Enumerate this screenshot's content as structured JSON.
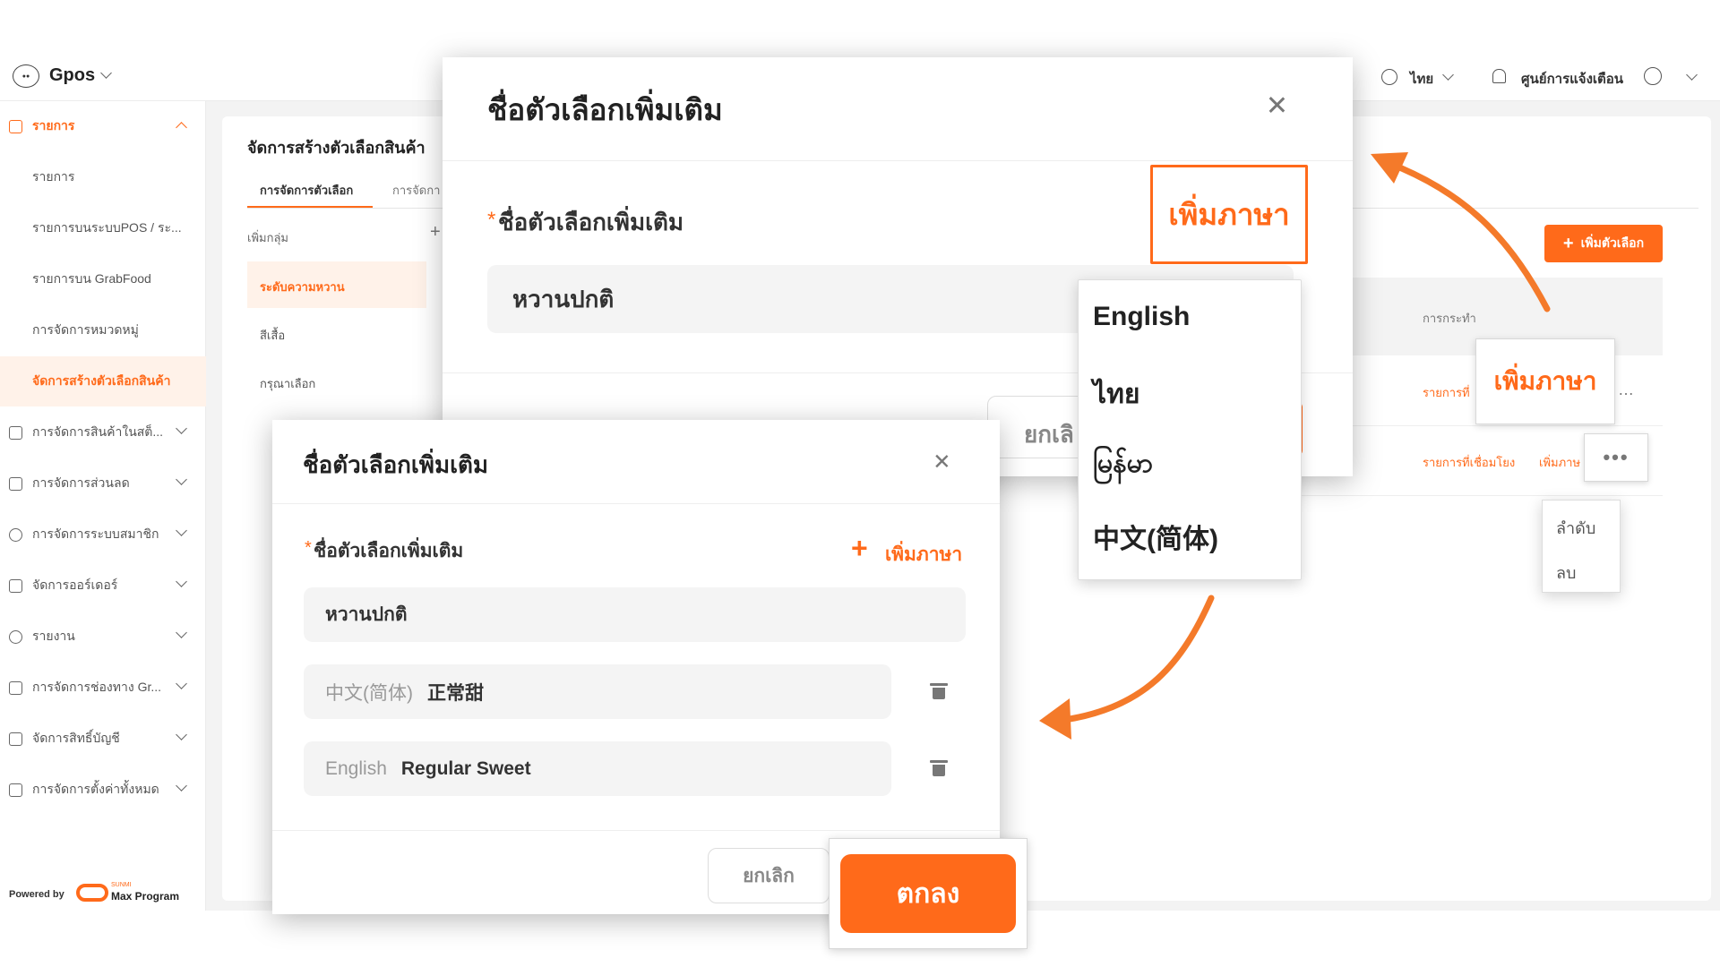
{
  "app": {
    "brand": "Gpos",
    "language": "ไทย",
    "notifications": "ศูนย์การแจ้งเตือน"
  },
  "sidebar": {
    "items": [
      {
        "label": "รายการ"
      },
      {
        "label": "รายการ"
      },
      {
        "label": "รายการบนระบบPOS / ระ..."
      },
      {
        "label": "รายการบน GrabFood"
      },
      {
        "label": "การจัดการหมวดหมู่"
      },
      {
        "label": "จัดการสร้างตัวเลือกสินค้า"
      },
      {
        "label": "การจัดการสินค้าในสต็..."
      },
      {
        "label": "การจัดการส่วนลด"
      },
      {
        "label": "การจัดการระบบสมาชิก"
      },
      {
        "label": "จัดการออร์เดอร์"
      },
      {
        "label": "รายงาน"
      },
      {
        "label": "การจัดการช่องทาง Gr..."
      },
      {
        "label": "จัดการสิทธิ์บัญชี"
      },
      {
        "label": "การจัดการตั้งค่าทั้งหมด"
      }
    ],
    "powered_by": "Powered by",
    "powered_brand": "Max Program",
    "powered_brand_small": "SUNMI"
  },
  "page": {
    "title": "จัดการสร้างตัวเลือกสินค้า",
    "tabs": [
      "การจัดการตัวเลือก",
      "การจัดกา"
    ],
    "add_group": "เพิ่มกลุ่ม",
    "add_group_icon": "+",
    "groups": [
      "ระดับความหวาน",
      "สีเสื้อ",
      "กรุณาเลือก"
    ],
    "add_option_button": "เพิ่มตัวเลือก",
    "table_header_action": "การกระทำ",
    "row1_action": "รายการที่",
    "row2_action_link": "รายการที่เชื่อมโยง",
    "row2_action_add": "เพิ่มภาษ",
    "more_menu": [
      "ลำดับ",
      "ลบ"
    ]
  },
  "modal_back": {
    "title": "ชื่อตัวเลือกเพิ่มเติม",
    "field_label": "ชื่อตัวเลือกเพิ่มเติม",
    "required_mark": "*",
    "field_value": "หวานปกติ",
    "add_language_button": "เพิ่มภาษา",
    "cancel": "ยกเลิ"
  },
  "language_dropdown": {
    "options": [
      "English",
      "ไทย",
      "မြန်မာ",
      "中文(简体)"
    ]
  },
  "callout_right": "เพิ่มภาษา",
  "modal_front": {
    "title": "ชื่อตัวเลือกเพิ่มเติม",
    "field_label": "ชื่อตัวเลือกเพิ่มเติม",
    "required_mark": "*",
    "add_language": "เพิ่มภาษา",
    "field_value": "หวานปกติ",
    "translations": [
      {
        "lang": "中文(简体)",
        "value": "正常甜"
      },
      {
        "lang": "English",
        "value": "Regular Sweet"
      }
    ],
    "cancel": "ยกเลิก",
    "ok": "ตกลง"
  },
  "colors": {
    "accent": "#ff6a1a",
    "background": "#f3f3f3",
    "sidebar_active_bg": "#fff2e9"
  }
}
